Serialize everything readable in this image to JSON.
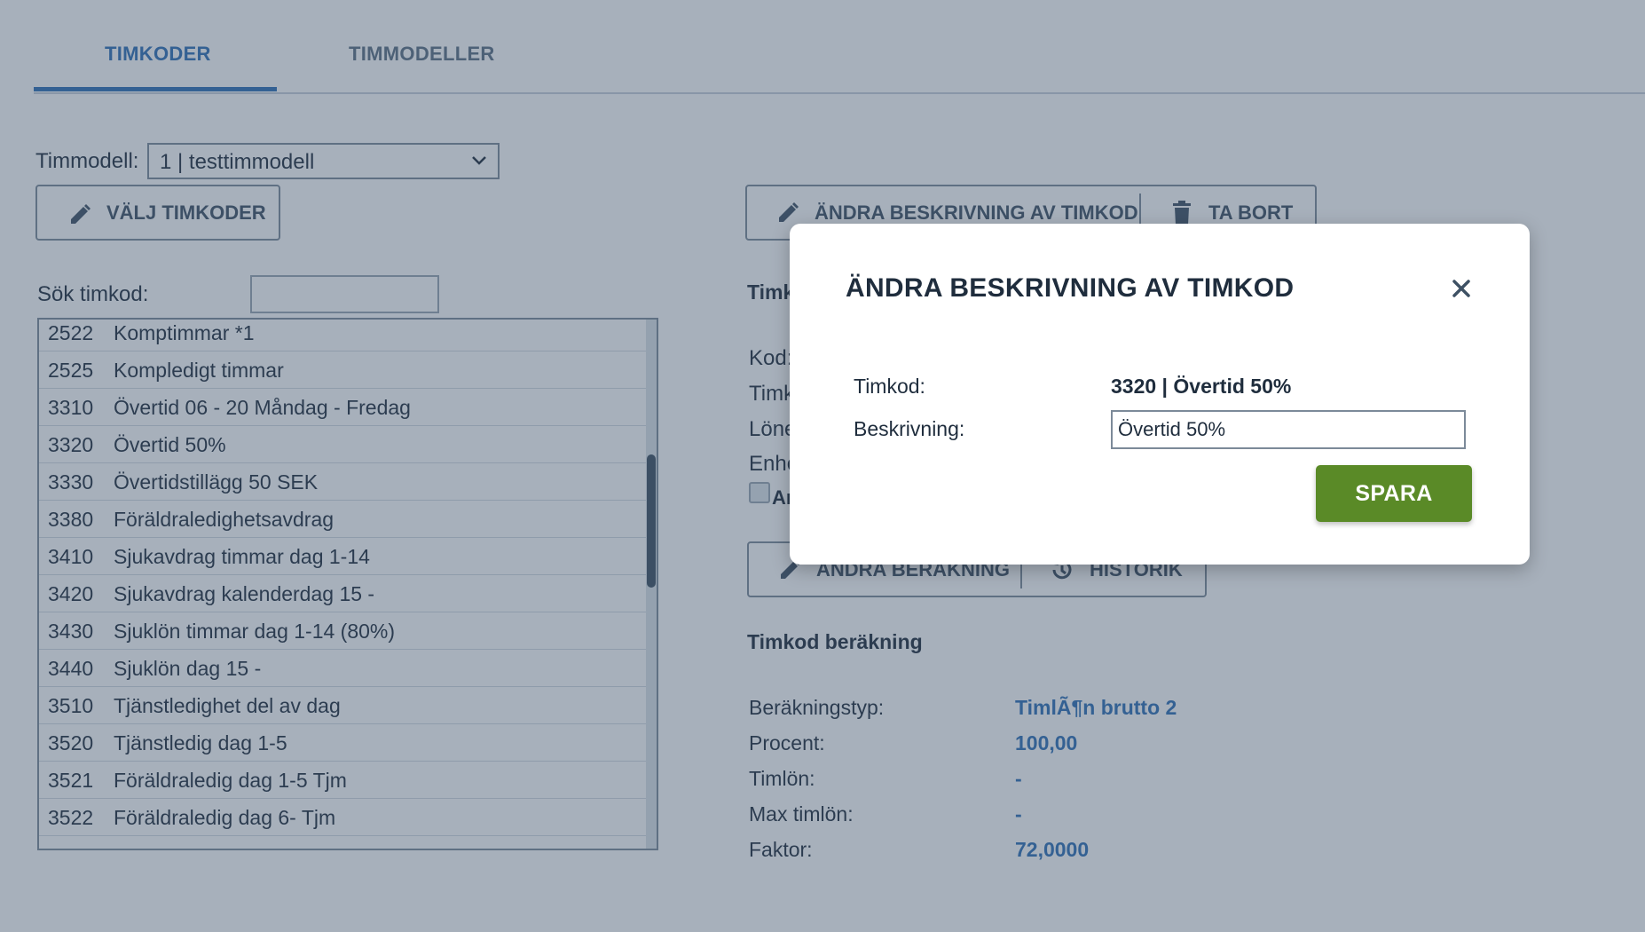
{
  "tabs": [
    {
      "label": "TIMKODER",
      "active": true
    },
    {
      "label": "TIMMODELLER",
      "active": false
    }
  ],
  "filter": {
    "timmodell_label": "Timmodell:",
    "timmodell_value": "1 | testtimmodell",
    "choose_button": "VÄLJ TIMKODER",
    "search_label": "Sök timkod:",
    "search_value": ""
  },
  "list": {
    "items": [
      {
        "code": "2522",
        "name": "Komptimmar *1"
      },
      {
        "code": "2525",
        "name": "Kompledigt timmar"
      },
      {
        "code": "3310",
        "name": "Övertid 06 - 20 Måndag - Fredag"
      },
      {
        "code": "3320",
        "name": "Övertid 50%"
      },
      {
        "code": "3330",
        "name": "Övertidstillägg 50 SEK"
      },
      {
        "code": "3380",
        "name": "Föräldraledighetsavdrag"
      },
      {
        "code": "3410",
        "name": "Sjukavdrag timmar dag 1-14"
      },
      {
        "code": "3420",
        "name": "Sjukavdrag kalenderdag 15 -"
      },
      {
        "code": "3430",
        "name": "Sjuklön timmar dag 1-14 (80%)"
      },
      {
        "code": "3440",
        "name": "Sjuklön dag 15 -"
      },
      {
        "code": "3510",
        "name": "Tjänstledighet del av dag"
      },
      {
        "code": "3520",
        "name": "Tjänstledig dag 1-5"
      },
      {
        "code": "3521",
        "name": "Föräldraledig dag 1-5 Tjm"
      },
      {
        "code": "3522",
        "name": "Föräldraledig dag 6- Tjm"
      }
    ]
  },
  "detail": {
    "edit_desc_button": "ÄNDRA BESKRIVNING AV TIMKOD",
    "delete_button": "TA BORT",
    "section_title_partial": "Timk",
    "field_labels_partial": [
      "Kod:",
      "Timk",
      "Löne",
      "Enhe"
    ],
    "checkbox_label_partial": "Ar",
    "edit_calc_button": "ÄNDRA BERÄKNING",
    "history_button": "HISTORIK",
    "calc_section_title": "Timkod beräkning",
    "calc_rows": [
      {
        "label": "Beräkningstyp:",
        "value": "TimlÃ¶n brutto 2"
      },
      {
        "label": "Procent:",
        "value": "100,00"
      },
      {
        "label": "Timlön:",
        "value": "-"
      },
      {
        "label": "Max timlön:",
        "value": "-"
      },
      {
        "label": "Faktor:",
        "value": "72,0000"
      }
    ]
  },
  "modal": {
    "title": "ÄNDRA BESKRIVNING AV TIMKOD",
    "timkod_label": "Timkod:",
    "timkod_value": "3320 | Övertid 50%",
    "desc_label": "Beskrivning:",
    "desc_value": "Övertid 50%",
    "save_label": "SPARA"
  },
  "colors": {
    "accent": "#2f6fb7",
    "save_green": "#5a8a27",
    "text": "#1f2d3d"
  },
  "icons": [
    "pencil-icon",
    "trash-icon",
    "history-icon",
    "close-icon",
    "chevron-down-icon"
  ]
}
